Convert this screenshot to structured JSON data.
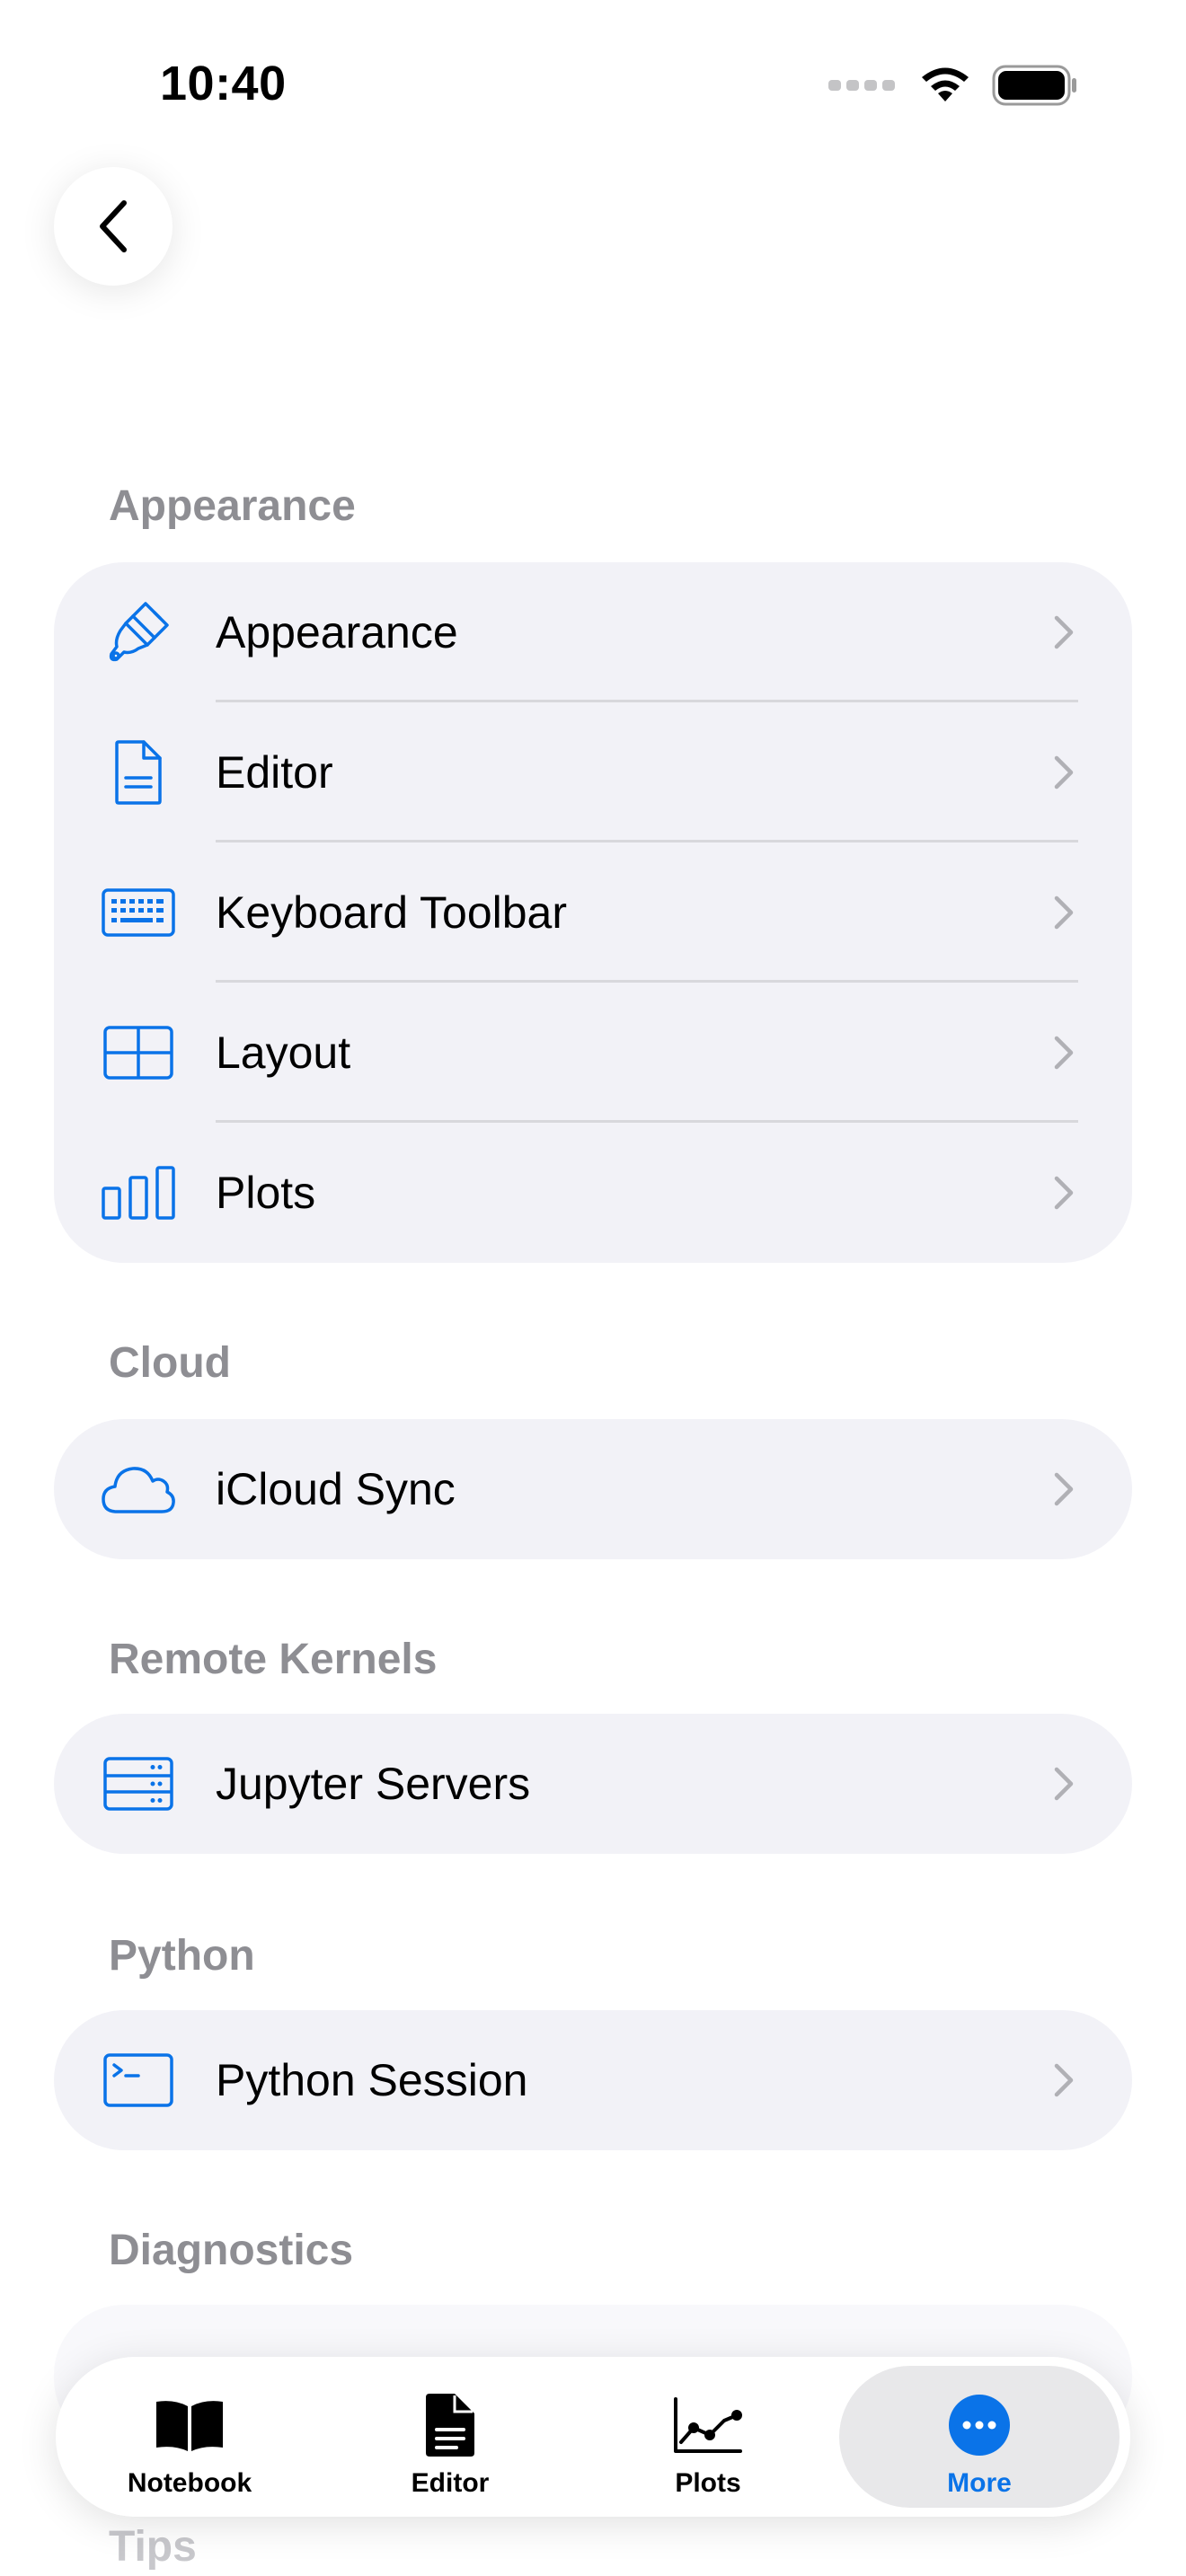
{
  "status_bar": {
    "time": "10:40"
  },
  "colors": {
    "accent": "#0a73e8",
    "section_header": "#8e8e93",
    "group_bg": "#f2f2f7"
  },
  "sections": [
    {
      "header": "Appearance",
      "items": [
        {
          "label": "Appearance",
          "icon": "paintbrush-icon"
        },
        {
          "label": "Editor",
          "icon": "document-icon"
        },
        {
          "label": "Keyboard Toolbar",
          "icon": "keyboard-icon"
        },
        {
          "label": "Layout",
          "icon": "layout-grid-icon"
        },
        {
          "label": "Plots",
          "icon": "bar-chart-icon"
        }
      ]
    },
    {
      "header": "Cloud",
      "items": [
        {
          "label": "iCloud Sync",
          "icon": "cloud-icon"
        }
      ]
    },
    {
      "header": "Remote Kernels",
      "items": [
        {
          "label": "Jupyter Servers",
          "icon": "server-icon"
        }
      ]
    },
    {
      "header": "Python",
      "items": [
        {
          "label": "Python Session",
          "icon": "terminal-icon"
        }
      ]
    },
    {
      "header": "Diagnostics",
      "items": []
    },
    {
      "header": "Tips",
      "items": []
    }
  ],
  "tab_bar": {
    "tabs": [
      {
        "label": "Notebook",
        "icon": "book-icon"
      },
      {
        "label": "Editor",
        "icon": "document-fill-icon"
      },
      {
        "label": "Plots",
        "icon": "line-chart-icon"
      },
      {
        "label": "More",
        "icon": "ellipsis-circle-icon",
        "active": true
      }
    ]
  }
}
